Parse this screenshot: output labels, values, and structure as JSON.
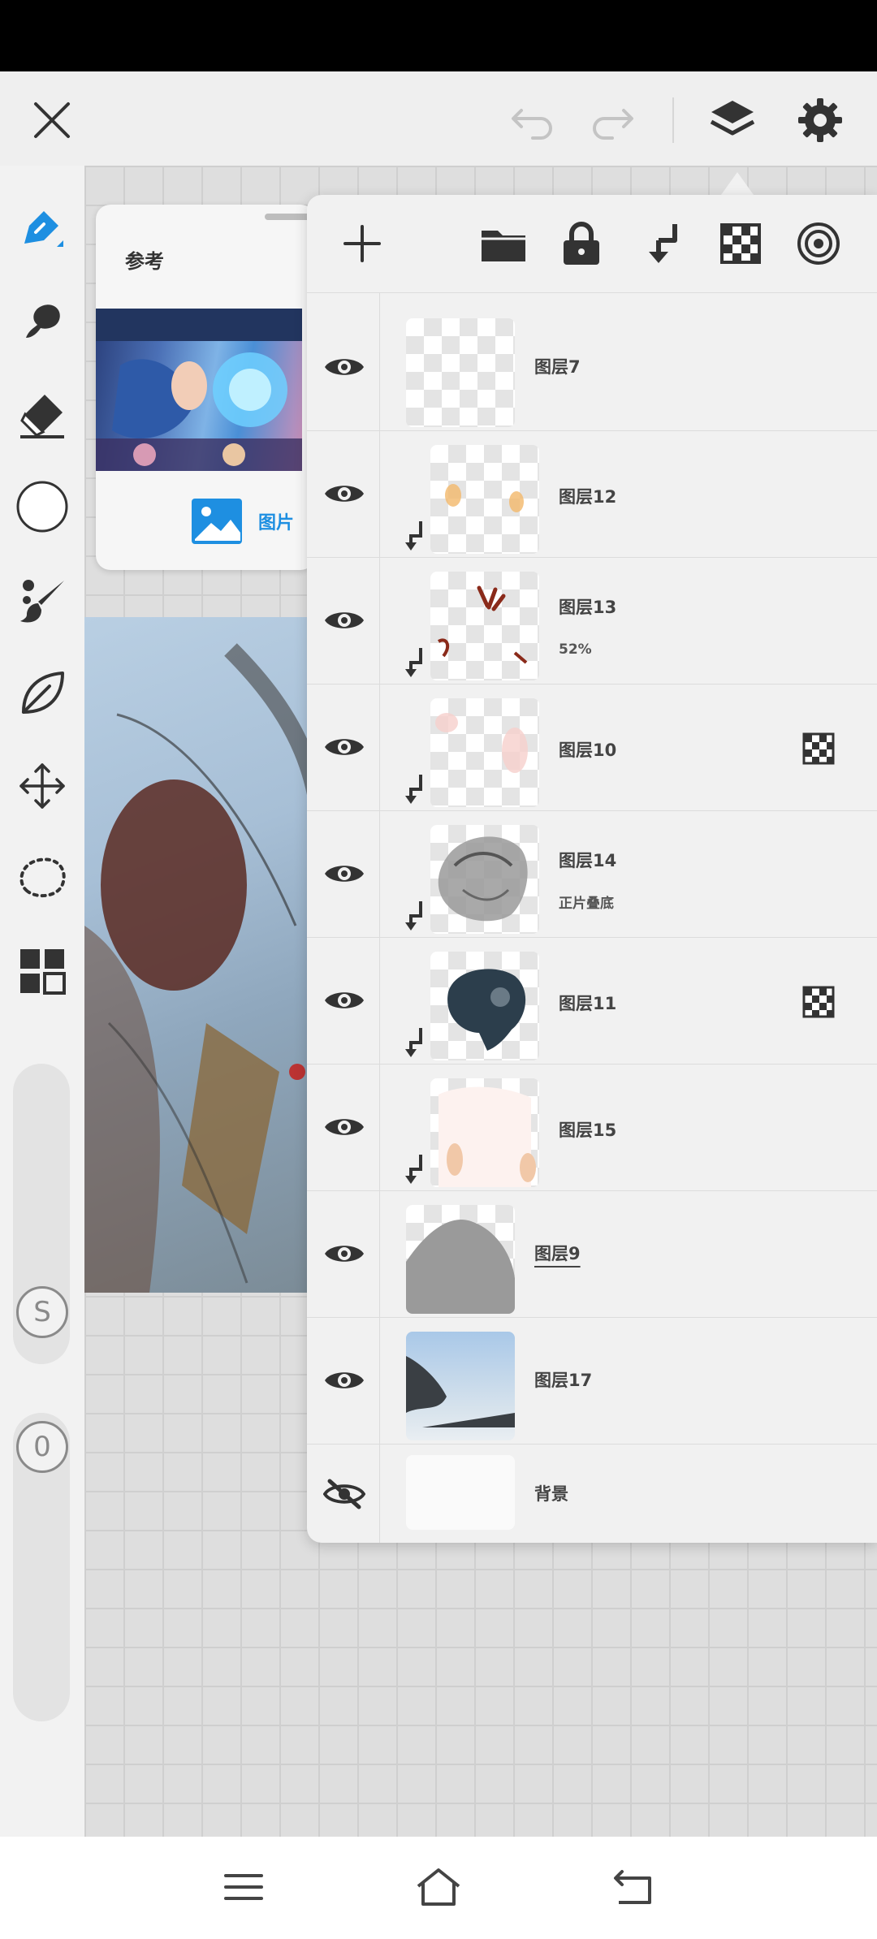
{
  "reference": {
    "title": "参考",
    "photo_label": "图片"
  },
  "layers": [
    {
      "name": "图层7",
      "subtitle": "",
      "visible": true,
      "clipped": false,
      "alpha_lock": false,
      "active": false
    },
    {
      "name": "图层12",
      "subtitle": "",
      "visible": true,
      "clipped": true,
      "alpha_lock": false,
      "active": false
    },
    {
      "name": "图层13",
      "subtitle": "52%",
      "visible": true,
      "clipped": true,
      "alpha_lock": false,
      "active": false
    },
    {
      "name": "图层10",
      "subtitle": "",
      "visible": true,
      "clipped": true,
      "alpha_lock": true,
      "active": false
    },
    {
      "name": "图层14",
      "subtitle": "正片叠底",
      "visible": true,
      "clipped": true,
      "alpha_lock": false,
      "active": false
    },
    {
      "name": "图层11",
      "subtitle": "",
      "visible": true,
      "clipped": true,
      "alpha_lock": true,
      "active": false
    },
    {
      "name": "图层15",
      "subtitle": "",
      "visible": true,
      "clipped": true,
      "alpha_lock": false,
      "active": false
    },
    {
      "name": "图层9",
      "subtitle": "",
      "visible": true,
      "clipped": false,
      "alpha_lock": false,
      "active": true
    },
    {
      "name": "图层17",
      "subtitle": "",
      "visible": true,
      "clipped": false,
      "alpha_lock": false,
      "active": false
    }
  ],
  "background_layer": {
    "name": "背景",
    "visible": false
  },
  "brush_slider": {
    "label": "S"
  },
  "opacity_slider": {
    "label": "0"
  },
  "colors": {
    "accent": "#1e8fe1",
    "current_color": "#ffffff"
  }
}
